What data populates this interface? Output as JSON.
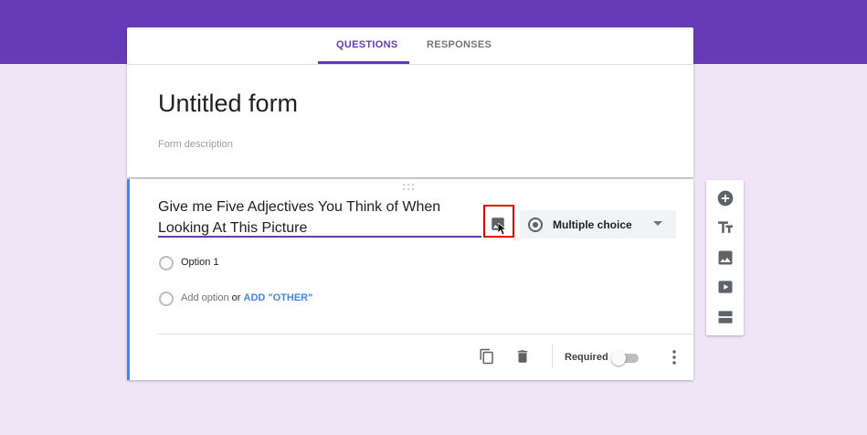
{
  "tabs": {
    "questions": "QUESTIONS",
    "responses": "RESPONSES"
  },
  "form": {
    "title": "Untitled form",
    "description_placeholder": "Form description"
  },
  "question": {
    "title_line1": "Give me Five Adjectives You Think of When",
    "title_line2": "Looking At This Picture",
    "type": "Multiple choice",
    "options": [
      "Option 1"
    ],
    "add_option": "Add option",
    "or": "or",
    "add_other": "ADD \"OTHER\"",
    "required_label": "Required",
    "required": false
  },
  "icons": {
    "add_question": "add-circle-icon",
    "add_title": "title-text-icon",
    "add_image": "image-icon",
    "add_video": "video-icon",
    "add_section": "section-icon",
    "duplicate": "copy-icon",
    "delete": "trash-icon",
    "more": "more-vert-icon"
  },
  "colors": {
    "theme": "#673ab7",
    "background": "#efe5f7",
    "active_bar": "#4285f4",
    "link": "#4285f4",
    "highlight": "#ee0000"
  }
}
